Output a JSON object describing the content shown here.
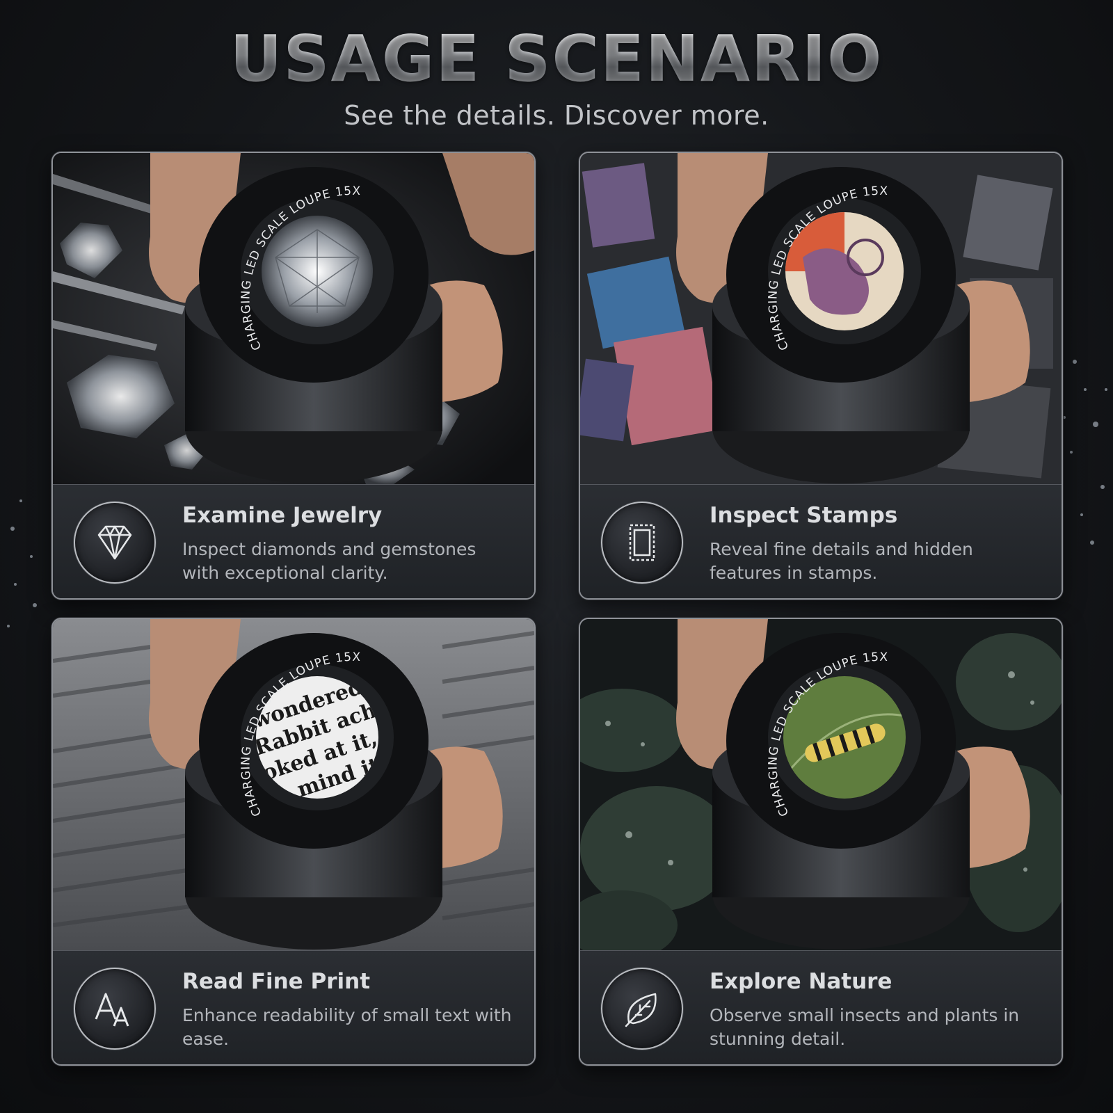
{
  "header": {
    "title": "USAGE SCENARIO",
    "subtitle": "See the details. Discover more."
  },
  "loupe_label": "CHARGING LED SCALE LOUPE 15X",
  "cards": [
    {
      "title": "Examine Jewelry",
      "description": "Inspect diamonds and gemstones with exceptional clarity.",
      "icon": "diamond-icon"
    },
    {
      "title": "Inspect Stamps",
      "description": "Reveal fine details and hidden features in stamps.",
      "icon": "stamp-icon"
    },
    {
      "title": "Read Fine Print",
      "description": "Enhance readability of small text with ease.",
      "icon": "font-size-icon"
    },
    {
      "title": "Explore Nature",
      "description": "Observe small insects and plants in stunning detail.",
      "icon": "leaf-icon"
    }
  ],
  "magnified_text": [
    "wondered",
    "Rabbit ach",
    "oked at it, a",
    "mind it"
  ]
}
